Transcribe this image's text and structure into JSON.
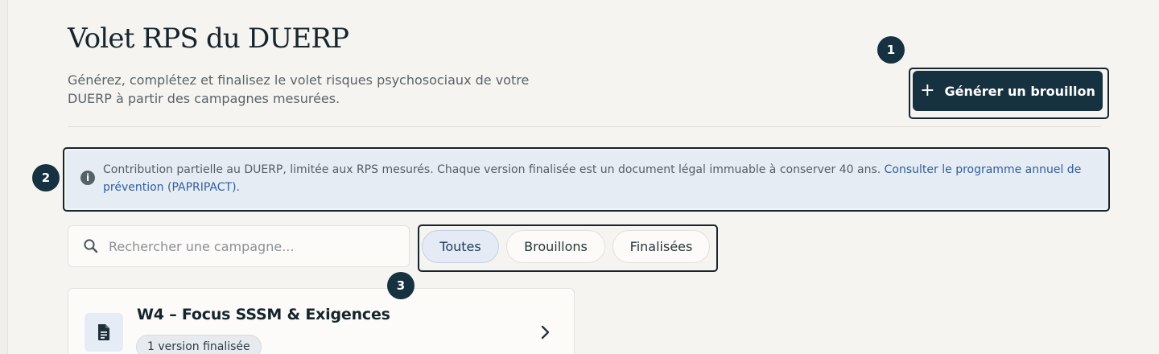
{
  "page": {
    "title": "Volet RPS du DUERP",
    "subtitle_line1": "Générez, complétez et finalisez le volet risques psychosociaux de votre",
    "subtitle_line2": "DUERP à partir des campagnes mesurées."
  },
  "header": {
    "generate_button_label": "Générer un brouillon",
    "generate_button_icon": "plus-icon"
  },
  "annotations": [
    "1",
    "2",
    "3"
  ],
  "info_banner": {
    "icon": "info-icon",
    "text": "Contribution partielle au DUERP, limitée aux RPS mesurés. Chaque version finalisée est un document légal immuable à conserver 40 ans. ",
    "link_text": "Consulter le programme annuel de prévention (PAPRIPACT)."
  },
  "search": {
    "icon": "search-icon",
    "placeholder": "Rechercher une campagne..."
  },
  "filters": [
    {
      "label": "Toutes",
      "active": true
    },
    {
      "label": "Brouillons",
      "active": false
    },
    {
      "label": "Finalisées",
      "active": false
    }
  ],
  "campaigns": [
    {
      "title": "W4 – Focus SSSM & Exigences",
      "badge": "1 version finalisée",
      "icon": "document-icon"
    }
  ],
  "colors": {
    "primary": "#163240",
    "background": "#f5f4f1",
    "info_background": "#e6ecf3",
    "link": "#2f5e9e",
    "active_filter": "#e4ebf5"
  }
}
